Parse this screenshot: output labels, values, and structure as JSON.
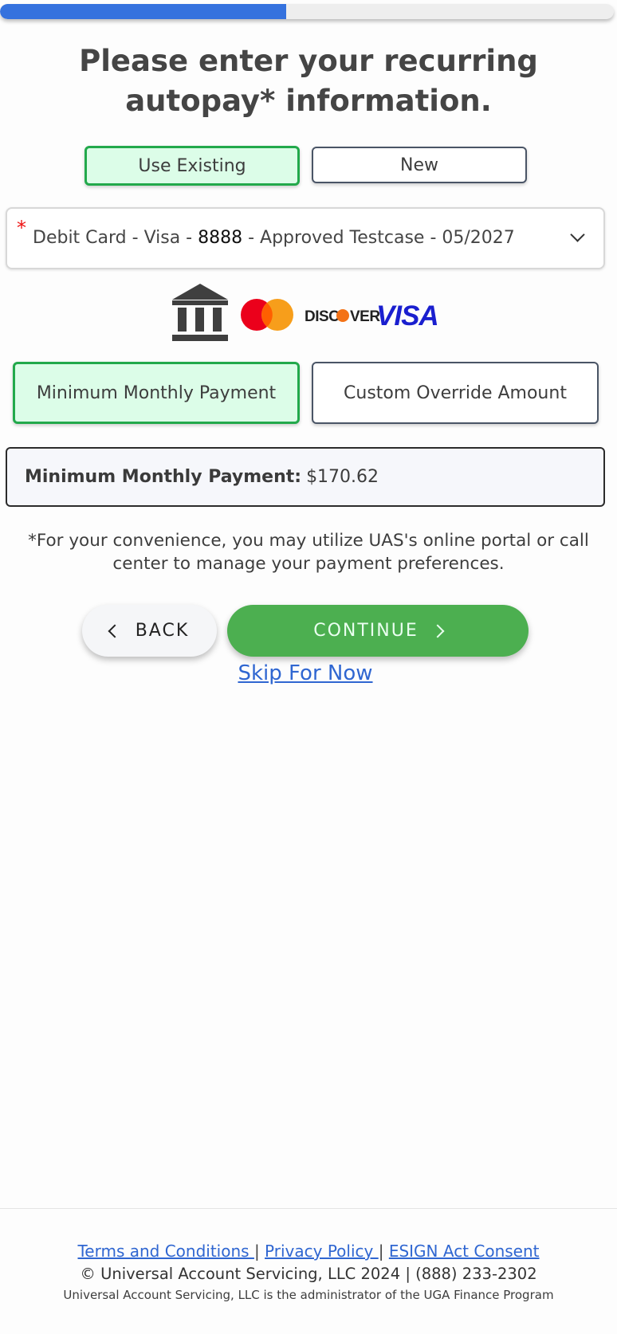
{
  "progress": {
    "percent": 46.6
  },
  "page": {
    "title": "Please enter your recurring autopay* information."
  },
  "source_toggle": {
    "existing_label": "Use Existing",
    "new_label": "New",
    "selected": "existing"
  },
  "payment_method": {
    "required_marker": "*",
    "prefix": "Debit Card - Visa - ",
    "last4": "8888",
    "suffix": " - Approved Testcase - 05/2027"
  },
  "brand_logos": {
    "icons": [
      "bank-icon",
      "mastercard-logo",
      "discover-logo",
      "visa-logo"
    ],
    "discover_text": "DISC",
    "discover_text2": "VER",
    "visa_text": "VISA"
  },
  "amount_toggle": {
    "minimum_label": "Minimum Monthly Payment",
    "custom_label": "Custom Override Amount",
    "selected": "minimum"
  },
  "summary": {
    "label": "Minimum Monthly Payment:",
    "value": "$170.62"
  },
  "note": "*For your convenience, you may utilize UAS's online portal or call center to manage your payment preferences.",
  "actions": {
    "back_label": "BACK",
    "continue_label": "CONTINUE",
    "skip_label": "Skip For Now"
  },
  "footer": {
    "terms": "Terms and Conditions ",
    "privacy": "Privacy Policy ",
    "esign": "ESIGN Act Consent",
    "separator": " | ",
    "copyright": "© Universal Account Servicing, LLC 2024 | (888) 233-2302",
    "admin": "Universal Account Servicing, LLC is the administrator of the UGA Finance Program"
  },
  "colors": {
    "accent_green": "#4caf50",
    "active_bg": "#dcfde8",
    "active_border": "#22a94b",
    "progress_blue": "#3572de",
    "link_blue": "#2f66d1"
  }
}
